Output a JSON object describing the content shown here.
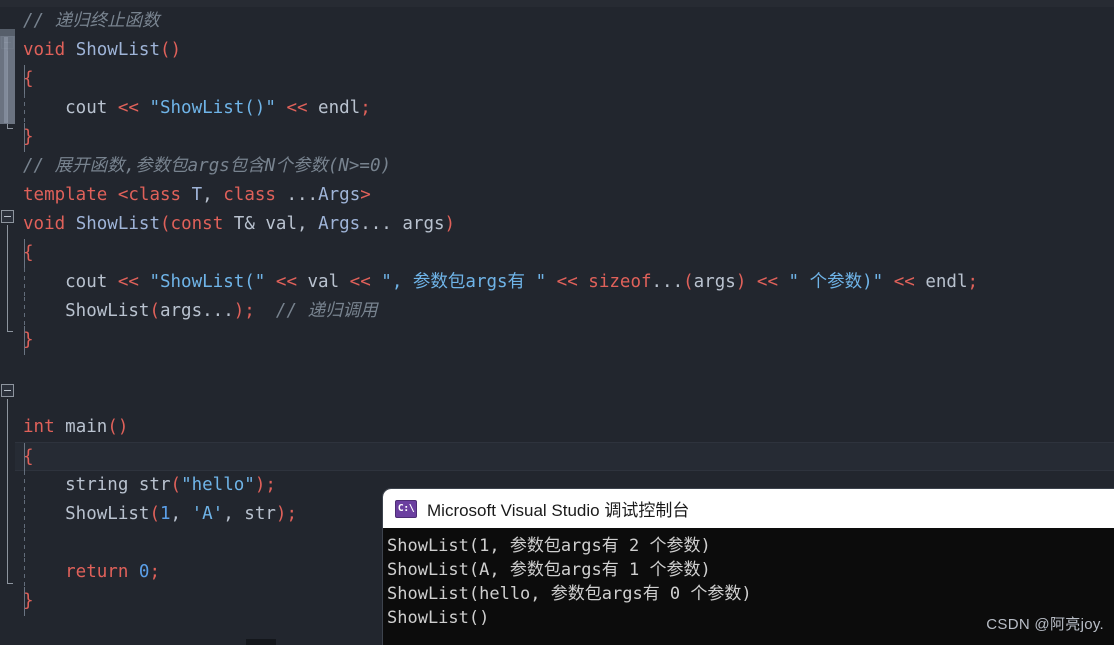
{
  "editor": {
    "language": "cpp",
    "background": "#22262e",
    "gutter": {
      "fold_markers": [
        "collapse-box",
        "collapse-box",
        "collapse-box"
      ],
      "scrollbar": "vertical-scroll-thumb"
    },
    "lines": [
      {
        "n": 1,
        "indent": 0,
        "guide": "none",
        "tokens": [
          {
            "t": "// 递归终止函数",
            "c": "cm"
          }
        ]
      },
      {
        "n": 2,
        "indent": 0,
        "guide": "none",
        "tokens": [
          {
            "t": "void",
            "c": "kw"
          },
          {
            "t": " ",
            "c": "id"
          },
          {
            "t": "ShowList",
            "c": "fn"
          },
          {
            "t": "()",
            "c": "pn"
          }
        ]
      },
      {
        "n": 3,
        "indent": 0,
        "guide": "bar",
        "tokens": [
          {
            "t": "{",
            "c": "pn"
          }
        ]
      },
      {
        "n": 4,
        "indent": 0,
        "guide": "dash",
        "tokens": [
          {
            "t": "    cout ",
            "c": "id"
          },
          {
            "t": "<<",
            "c": "op"
          },
          {
            "t": " ",
            "c": "id"
          },
          {
            "t": "\"ShowList()\"",
            "c": "str"
          },
          {
            "t": " ",
            "c": "id"
          },
          {
            "t": "<<",
            "c": "op"
          },
          {
            "t": " endl",
            "c": "id"
          },
          {
            "t": ";",
            "c": "pn"
          }
        ]
      },
      {
        "n": 5,
        "indent": 0,
        "guide": "bar",
        "tokens": [
          {
            "t": "}",
            "c": "pn"
          }
        ]
      },
      {
        "n": 6,
        "indent": 0,
        "guide": "none",
        "tokens": [
          {
            "t": "// 展开函数,参数包args包含N个参数(N>=0)",
            "c": "cm"
          }
        ]
      },
      {
        "n": 7,
        "indent": 0,
        "guide": "none",
        "tokens": [
          {
            "t": "template",
            "c": "kw"
          },
          {
            "t": " ",
            "c": "id"
          },
          {
            "t": "<",
            "c": "op"
          },
          {
            "t": "class",
            "c": "kw"
          },
          {
            "t": " ",
            "c": "id"
          },
          {
            "t": "T",
            "c": "ty"
          },
          {
            "t": ", ",
            "c": "id"
          },
          {
            "t": "class",
            "c": "kw"
          },
          {
            "t": " ...",
            "c": "id"
          },
          {
            "t": "Args",
            "c": "ty"
          },
          {
            "t": ">",
            "c": "op"
          }
        ]
      },
      {
        "n": 8,
        "indent": 0,
        "guide": "none",
        "tokens": [
          {
            "t": "void",
            "c": "kw"
          },
          {
            "t": " ",
            "c": "id"
          },
          {
            "t": "ShowList",
            "c": "fn"
          },
          {
            "t": "(",
            "c": "pn"
          },
          {
            "t": "const",
            "c": "kw"
          },
          {
            "t": " ",
            "c": "id"
          },
          {
            "t": "T& val",
            "c": "id"
          },
          {
            "t": ", ",
            "c": "id"
          },
          {
            "t": "Args",
            "c": "ty"
          },
          {
            "t": "... args",
            "c": "id"
          },
          {
            "t": ")",
            "c": "pn"
          }
        ]
      },
      {
        "n": 9,
        "indent": 0,
        "guide": "bar",
        "tokens": [
          {
            "t": "{",
            "c": "pn"
          }
        ]
      },
      {
        "n": 10,
        "indent": 0,
        "guide": "dash",
        "tokens": [
          {
            "t": "    cout ",
            "c": "id"
          },
          {
            "t": "<<",
            "c": "op"
          },
          {
            "t": " ",
            "c": "id"
          },
          {
            "t": "\"ShowList(\"",
            "c": "str"
          },
          {
            "t": " ",
            "c": "id"
          },
          {
            "t": "<<",
            "c": "op"
          },
          {
            "t": " val ",
            "c": "id"
          },
          {
            "t": "<<",
            "c": "op"
          },
          {
            "t": " ",
            "c": "id"
          },
          {
            "t": "\", 参数包args有 \"",
            "c": "str"
          },
          {
            "t": " ",
            "c": "id"
          },
          {
            "t": "<<",
            "c": "op"
          },
          {
            "t": " ",
            "c": "id"
          },
          {
            "t": "sizeof",
            "c": "kw"
          },
          {
            "t": "...",
            "c": "id"
          },
          {
            "t": "(",
            "c": "pn"
          },
          {
            "t": "args",
            "c": "id"
          },
          {
            "t": ")",
            "c": "pn"
          },
          {
            "t": " ",
            "c": "id"
          },
          {
            "t": "<<",
            "c": "op"
          },
          {
            "t": " ",
            "c": "id"
          },
          {
            "t": "\" 个参数)\"",
            "c": "str"
          },
          {
            "t": " ",
            "c": "id"
          },
          {
            "t": "<<",
            "c": "op"
          },
          {
            "t": " endl",
            "c": "id"
          },
          {
            "t": ";",
            "c": "pn"
          }
        ]
      },
      {
        "n": 11,
        "indent": 0,
        "guide": "dash",
        "tokens": [
          {
            "t": "    ShowList",
            "c": "id"
          },
          {
            "t": "(",
            "c": "pn"
          },
          {
            "t": "args...",
            "c": "id"
          },
          {
            "t": ")",
            "c": "pn"
          },
          {
            "t": ";",
            "c": "pn"
          },
          {
            "t": "  ",
            "c": "id"
          },
          {
            "t": "// 递归调用",
            "c": "cm"
          }
        ]
      },
      {
        "n": 12,
        "indent": 0,
        "guide": "bar",
        "tokens": [
          {
            "t": "}",
            "c": "pn"
          }
        ]
      },
      {
        "n": 13,
        "indent": 0,
        "guide": "none",
        "tokens": []
      },
      {
        "n": 14,
        "indent": 0,
        "guide": "none",
        "tokens": []
      },
      {
        "n": 15,
        "indent": 0,
        "guide": "none",
        "tokens": [
          {
            "t": "int",
            "c": "kw"
          },
          {
            "t": " ",
            "c": "id"
          },
          {
            "t": "main",
            "c": "id"
          },
          {
            "t": "()",
            "c": "pn"
          }
        ]
      },
      {
        "n": 16,
        "indent": 0,
        "guide": "bar",
        "current": true,
        "tokens": [
          {
            "t": "{",
            "c": "pn"
          }
        ]
      },
      {
        "n": 17,
        "indent": 0,
        "guide": "dash",
        "tokens": [
          {
            "t": "    string str",
            "c": "id"
          },
          {
            "t": "(",
            "c": "pn"
          },
          {
            "t": "\"hello\"",
            "c": "str"
          },
          {
            "t": ")",
            "c": "pn"
          },
          {
            "t": ";",
            "c": "pn"
          }
        ]
      },
      {
        "n": 18,
        "indent": 0,
        "guide": "dash",
        "tokens": [
          {
            "t": "    ShowList",
            "c": "id"
          },
          {
            "t": "(",
            "c": "pn"
          },
          {
            "t": "1",
            "c": "num"
          },
          {
            "t": ", ",
            "c": "id"
          },
          {
            "t": "'A'",
            "c": "str"
          },
          {
            "t": ", str",
            "c": "id"
          },
          {
            "t": ")",
            "c": "pn"
          },
          {
            "t": ";",
            "c": "pn"
          }
        ]
      },
      {
        "n": 19,
        "indent": 0,
        "guide": "dash",
        "tokens": []
      },
      {
        "n": 20,
        "indent": 0,
        "guide": "dash",
        "tokens": [
          {
            "t": "    return",
            "c": "kw"
          },
          {
            "t": " ",
            "c": "id"
          },
          {
            "t": "0",
            "c": "num"
          },
          {
            "t": ";",
            "c": "pn"
          }
        ]
      },
      {
        "n": 21,
        "indent": 0,
        "guide": "bar",
        "tokens": [
          {
            "t": "}",
            "c": "pn"
          }
        ]
      },
      {
        "n": 22,
        "indent": 0,
        "guide": "none",
        "tokens": []
      }
    ]
  },
  "console": {
    "icon": "command-prompt-icon",
    "icon_glyph": "C:\\",
    "title": "Microsoft Visual Studio 调试控制台",
    "output_lines": [
      "ShowList(1, 参数包args有 2 个参数)",
      "ShowList(A, 参数包args有 1 个参数)",
      "ShowList(hello, 参数包args有 0 个参数)",
      "ShowList()"
    ],
    "background": "#0c0c0c",
    "title_background": "#ffffff",
    "text_color": "#cfcfcf"
  },
  "watermark": {
    "text": "CSDN @阿亮joy."
  }
}
